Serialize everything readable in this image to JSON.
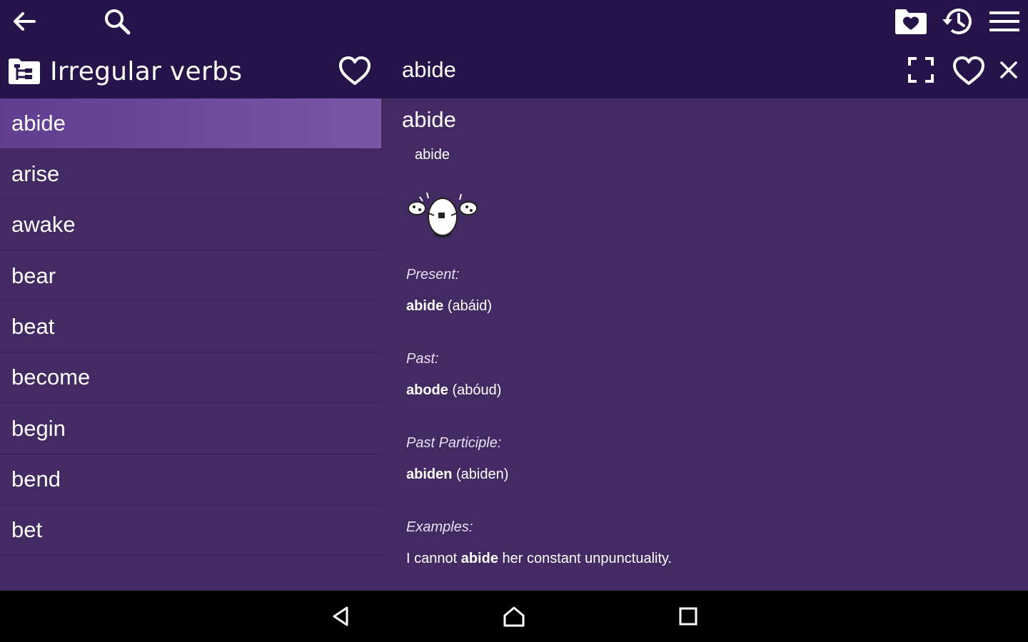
{
  "toolbar": {
    "back_icon": "arrow-left-icon",
    "search_icon": "search-icon",
    "favorites_folder_icon": "folder-heart-icon",
    "history_icon": "history-icon",
    "menu_icon": "hamburger-menu-icon"
  },
  "left_panel": {
    "title": "Irregular verbs",
    "title_icon": "hierarchy-folder-icon",
    "favorite_icon": "heart-outline-icon"
  },
  "right_panel": {
    "title": "abide",
    "fullscreen_icon": "fullscreen-icon",
    "favorite_icon": "heart-outline-icon",
    "close_icon": "close-icon"
  },
  "verbs": [
    {
      "label": "abide"
    },
    {
      "label": "arise"
    },
    {
      "label": "awake"
    },
    {
      "label": "bear"
    },
    {
      "label": "beat"
    },
    {
      "label": "become"
    },
    {
      "label": "begin"
    },
    {
      "label": "bend"
    },
    {
      "label": "bet"
    }
  ],
  "selected_index": 0,
  "detail": {
    "word": "abide",
    "subtitle": "abide",
    "present_label": "Present:",
    "present_word": "abide",
    "present_pron": "(abáid)",
    "past_label": "Past:",
    "past_word": "abode",
    "past_pron": "(abóud)",
    "pp_label": "Past Participle:",
    "pp_word": "abiden",
    "pp_pron": "(abiden)",
    "examples_label": "Examples:",
    "example_pre": "I cannot ",
    "example_bold": "abide",
    "example_post": " her constant unpunctuality."
  },
  "navbar": {
    "back_icon": "nav-back-icon",
    "home_icon": "nav-home-icon",
    "recents_icon": "nav-recents-icon"
  },
  "colors": {
    "toolbar_bg": "#26134a",
    "pane_bg": "#432a63",
    "selected_bg": "#6a4899"
  }
}
